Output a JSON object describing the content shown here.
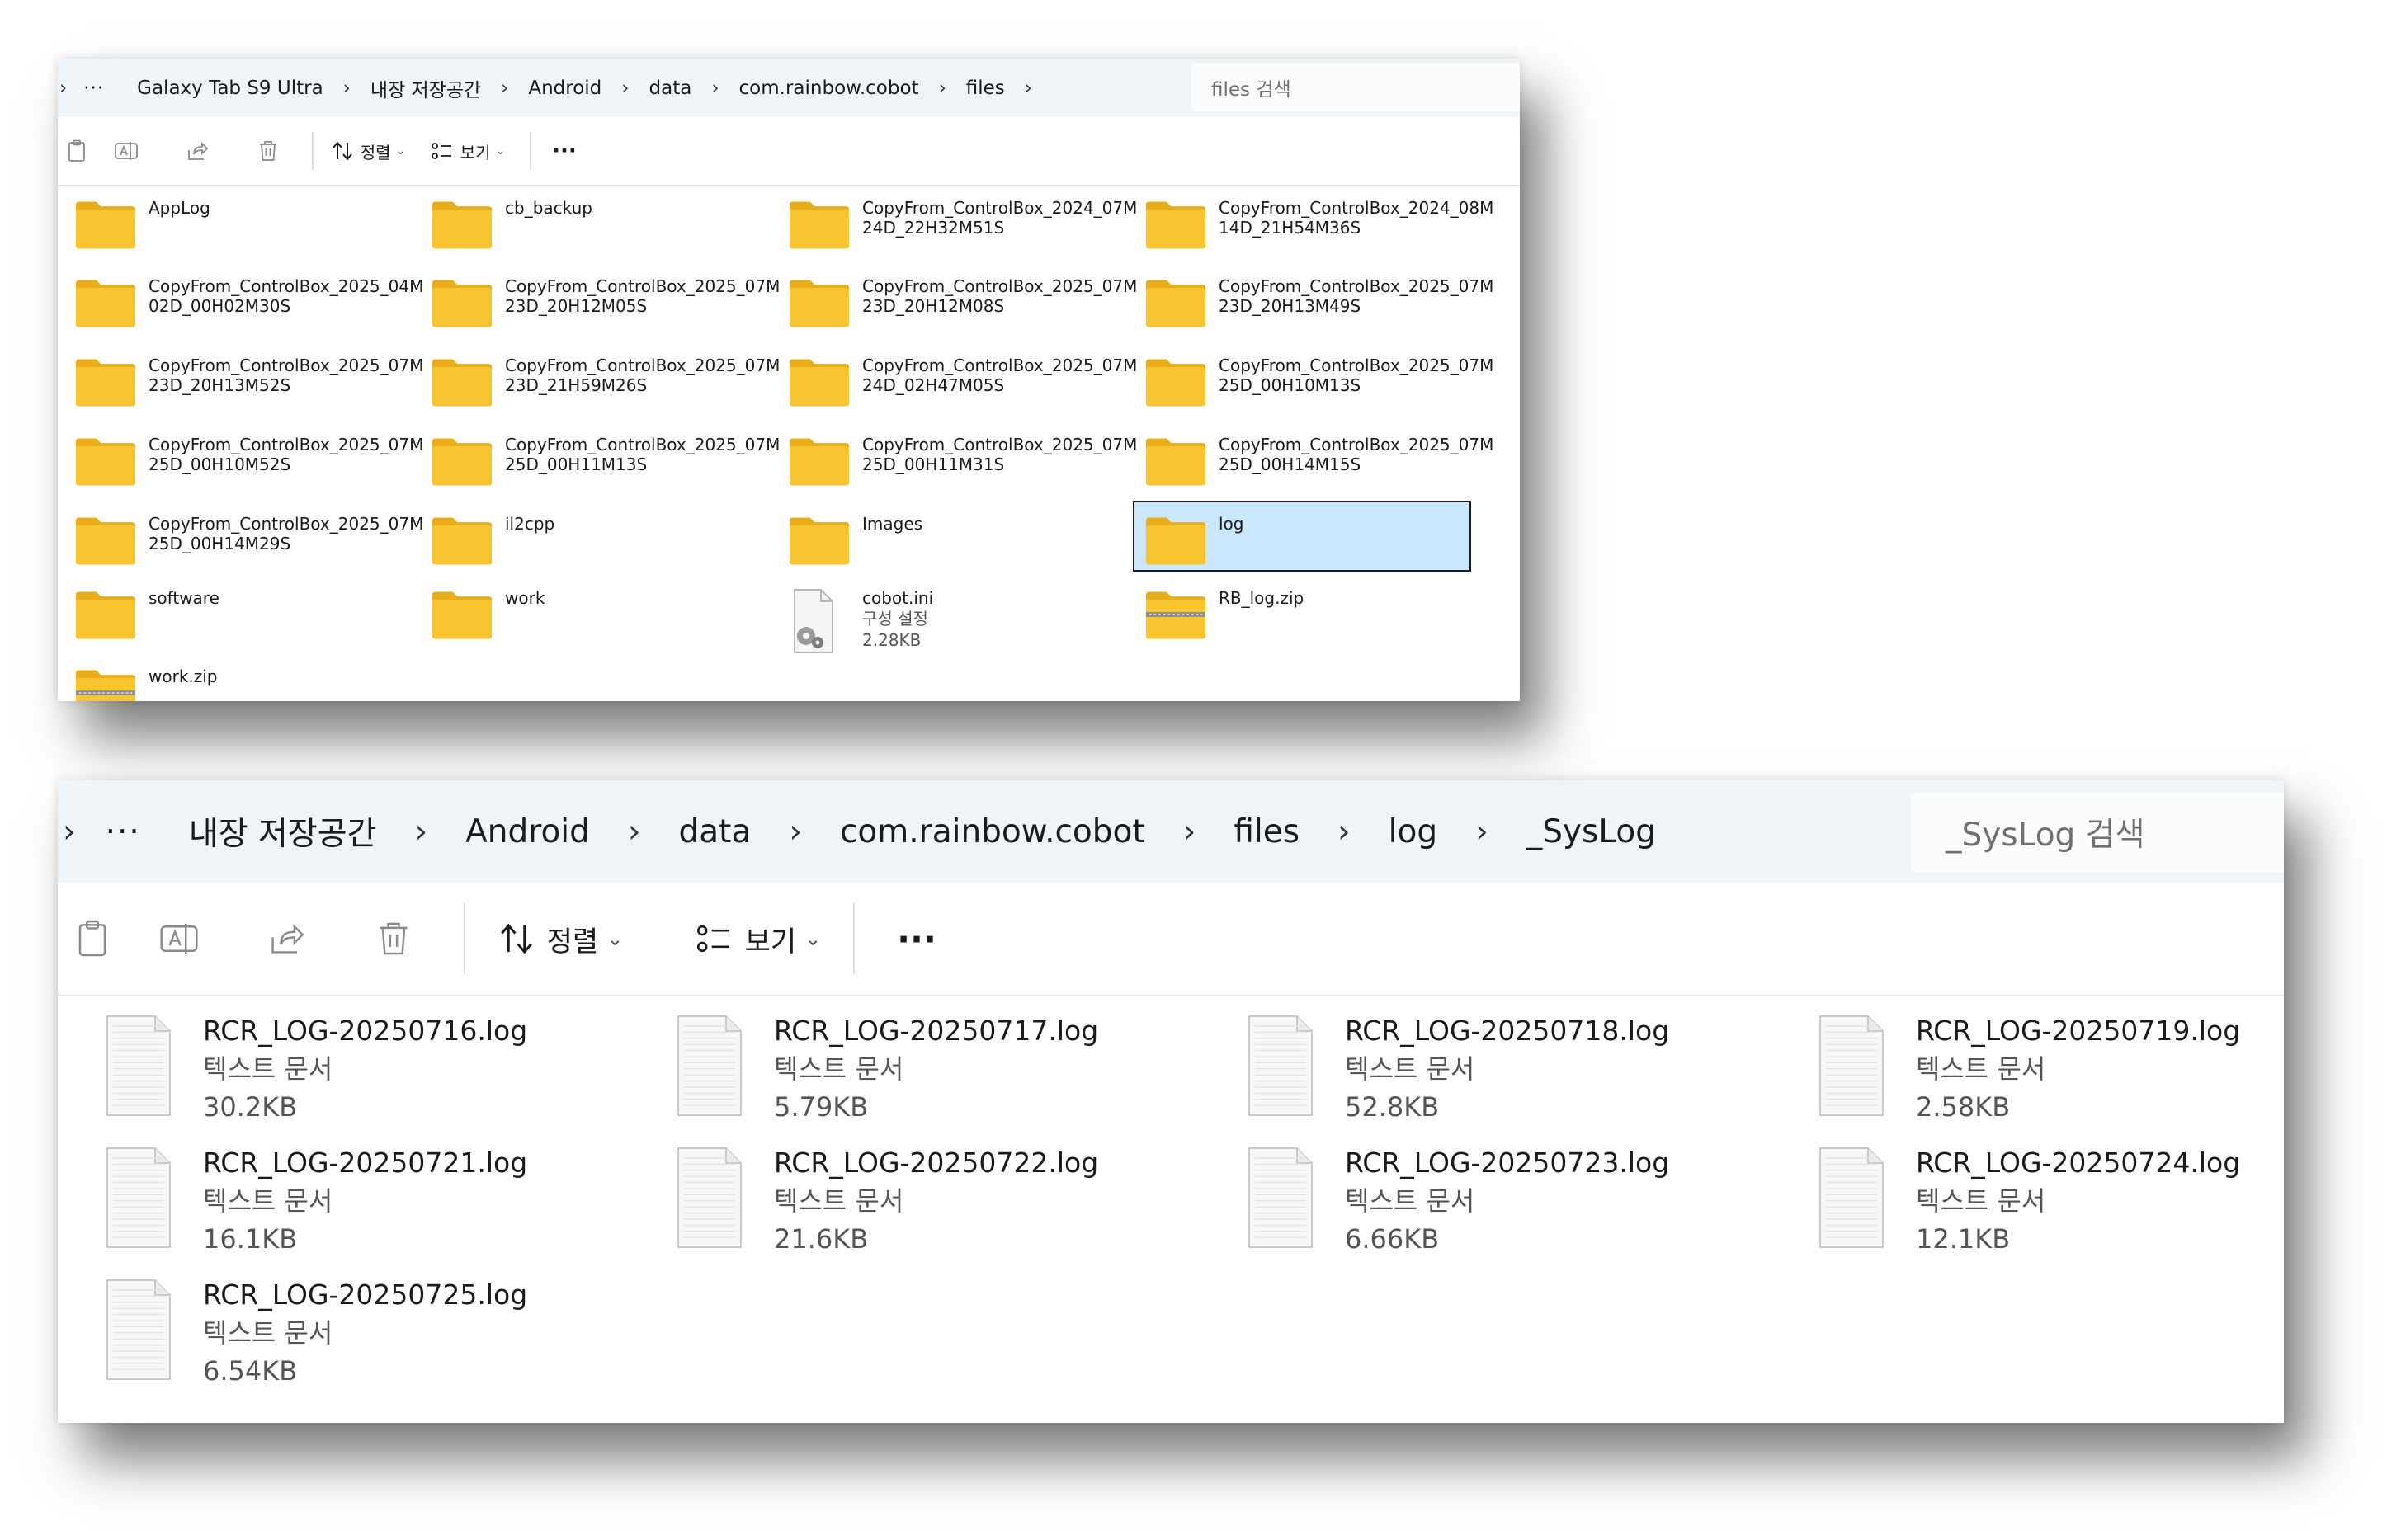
{
  "window1": {
    "breadcrumbs": [
      "Galaxy Tab S9 Ultra",
      "내장 저장공간",
      "Android",
      "data",
      "com.rainbow.cobot",
      "files"
    ],
    "search_placeholder": "files 검색",
    "toolbar": {
      "sort_label": "정렬",
      "view_label": "보기",
      "more_label": "···"
    },
    "items": [
      {
        "type": "folder",
        "name": "AppLog"
      },
      {
        "type": "folder",
        "name": "cb_backup"
      },
      {
        "type": "folder",
        "name": "CopyFrom_ControlBox_2024_07M",
        "name2": "24D_22H32M51S"
      },
      {
        "type": "folder",
        "name": "CopyFrom_ControlBox_2024_08M",
        "name2": "14D_21H54M36S"
      },
      {
        "type": "folder",
        "name": "CopyFrom_ControlBox_2025_04M",
        "name2": "02D_00H02M30S"
      },
      {
        "type": "folder",
        "name": "CopyFrom_ControlBox_2025_07M",
        "name2": "23D_20H12M05S"
      },
      {
        "type": "folder",
        "name": "CopyFrom_ControlBox_2025_07M",
        "name2": "23D_20H12M08S"
      },
      {
        "type": "folder",
        "name": "CopyFrom_ControlBox_2025_07M",
        "name2": "23D_20H13M49S"
      },
      {
        "type": "folder",
        "name": "CopyFrom_ControlBox_2025_07M",
        "name2": "23D_20H13M52S"
      },
      {
        "type": "folder",
        "name": "CopyFrom_ControlBox_2025_07M",
        "name2": "23D_21H59M26S"
      },
      {
        "type": "folder",
        "name": "CopyFrom_ControlBox_2025_07M",
        "name2": "24D_02H47M05S"
      },
      {
        "type": "folder",
        "name": "CopyFrom_ControlBox_2025_07M",
        "name2": "25D_00H10M13S"
      },
      {
        "type": "folder",
        "name": "CopyFrom_ControlBox_2025_07M",
        "name2": "25D_00H10M52S"
      },
      {
        "type": "folder",
        "name": "CopyFrom_ControlBox_2025_07M",
        "name2": "25D_00H11M13S"
      },
      {
        "type": "folder",
        "name": "CopyFrom_ControlBox_2025_07M",
        "name2": "25D_00H11M31S"
      },
      {
        "type": "folder",
        "name": "CopyFrom_ControlBox_2025_07M",
        "name2": "25D_00H14M15S"
      },
      {
        "type": "folder",
        "name": "CopyFrom_ControlBox_2025_07M",
        "name2": "25D_00H14M29S"
      },
      {
        "type": "folder",
        "name": "il2cpp"
      },
      {
        "type": "folder",
        "name": "Images"
      },
      {
        "type": "folder",
        "name": "log",
        "selected": true
      },
      {
        "type": "folder",
        "name": "software"
      },
      {
        "type": "folder",
        "name": "work"
      },
      {
        "type": "ini",
        "name": "cobot.ini",
        "sub1": "구성 설정",
        "sub2": "2.28KB"
      },
      {
        "type": "zip",
        "name": "RB_log.zip"
      },
      {
        "type": "zip",
        "name": "work.zip"
      }
    ]
  },
  "window2": {
    "breadcrumbs": [
      "내장 저장공간",
      "Android",
      "data",
      "com.rainbow.cobot",
      "files",
      "log",
      "_SysLog"
    ],
    "search_placeholder": "_SysLog 검색",
    "toolbar": {
      "sort_label": "정렬",
      "view_label": "보기",
      "more_label": "···"
    },
    "files": [
      {
        "name": "RCR_LOG-20250716.log",
        "type": "텍스트 문서",
        "size": "30.2KB"
      },
      {
        "name": "RCR_LOG-20250717.log",
        "type": "텍스트 문서",
        "size": "5.79KB"
      },
      {
        "name": "RCR_LOG-20250718.log",
        "type": "텍스트 문서",
        "size": "52.8KB"
      },
      {
        "name": "RCR_LOG-20250719.log",
        "type": "텍스트 문서",
        "size": "2.58KB"
      },
      {
        "name": "RCR_LOG-20250721.log",
        "type": "텍스트 문서",
        "size": "16.1KB"
      },
      {
        "name": "RCR_LOG-20250722.log",
        "type": "텍스트 문서",
        "size": "21.6KB"
      },
      {
        "name": "RCR_LOG-20250723.log",
        "type": "텍스트 문서",
        "size": "6.66KB"
      },
      {
        "name": "RCR_LOG-20250724.log",
        "type": "텍스트 문서",
        "size": "12.1KB"
      },
      {
        "name": "RCR_LOG-20250725.log",
        "type": "텍스트 문서",
        "size": "6.54KB"
      }
    ]
  },
  "colors": {
    "folder": "#f8c530",
    "folder_back": "#e8ad1a",
    "selection": "#cce8ff",
    "address_bg": "#eff4f9"
  }
}
